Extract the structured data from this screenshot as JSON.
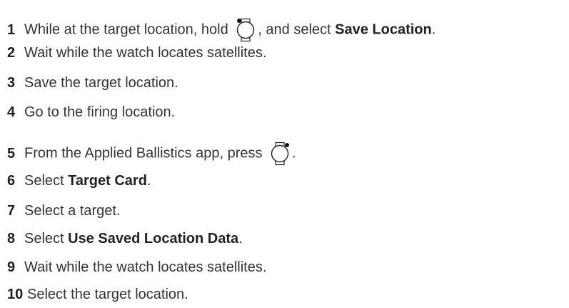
{
  "steps": [
    {
      "number": "1",
      "before": "While at the target location, hold ",
      "icon": "watch-top-left-button-icon",
      "after": ", and select ",
      "bold": "Save Location",
      "end": "."
    },
    {
      "number": "2",
      "text": "Wait while the watch locates satellites."
    },
    {
      "number": "3",
      "text": "Save the target location."
    },
    {
      "number": "4",
      "text": "Go to the firing location."
    },
    {
      "number": "5",
      "before": "From the Applied Ballistics app, press ",
      "icon": "watch-top-right-button-icon",
      "end": "."
    },
    {
      "number": "6",
      "before": "Select ",
      "bold": "Target Card",
      "end": "."
    },
    {
      "number": "7",
      "text": "Select a target."
    },
    {
      "number": "8",
      "before": "Select ",
      "bold": "Use Saved Location Data",
      "end": "."
    },
    {
      "number": "9",
      "text": "Wait while the watch locates satellites."
    },
    {
      "number": "10",
      "text": "Select the target location."
    }
  ]
}
